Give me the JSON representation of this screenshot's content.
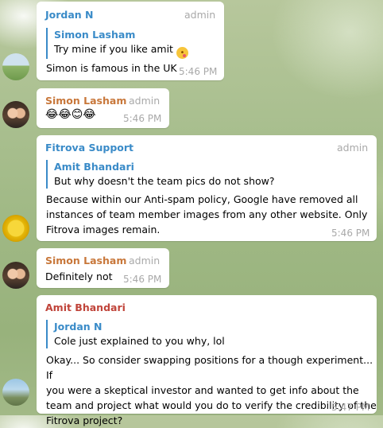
{
  "messages": [
    {
      "sender": "Jordan N",
      "role": "admin",
      "quote": {
        "name": "Simon Lasham",
        "text": "Try mine if you like amit"
      },
      "text": "Simon is famous in the UK",
      "time": "5:46 PM"
    },
    {
      "sender": "Simon Lasham",
      "role": "admin",
      "text": "😂😂😊😂",
      "time": "5:46 PM"
    },
    {
      "sender": "Fitrova Support",
      "role": "admin",
      "quote": {
        "name": "Amit Bhandari",
        "text": "But why doesn't the team pics do not show?"
      },
      "text": "Because within our Anti-spam policy, Google have removed all\ninstances of team member images from any other website. Only\nFitrova images remain.",
      "time": "5:46 PM"
    },
    {
      "sender": "Simon Lasham",
      "role": "admin",
      "text": "Definitely not",
      "time": "5:46 PM"
    },
    {
      "sender": "Amit Bhandari",
      "quote": {
        "name": "Jordan N",
        "text": "Cole just explained to you why, lol"
      },
      "text": "Okay... So consider swapping positions for a though experiment... If\nyou were a skeptical investor and wanted to get info about the\nteam and project what would you do to verify the credibility of the\nFitrova project?",
      "time": "5:47 PM"
    }
  ],
  "icons": {
    "tongue_emoji": "winking-face-with-tongue-icon"
  }
}
